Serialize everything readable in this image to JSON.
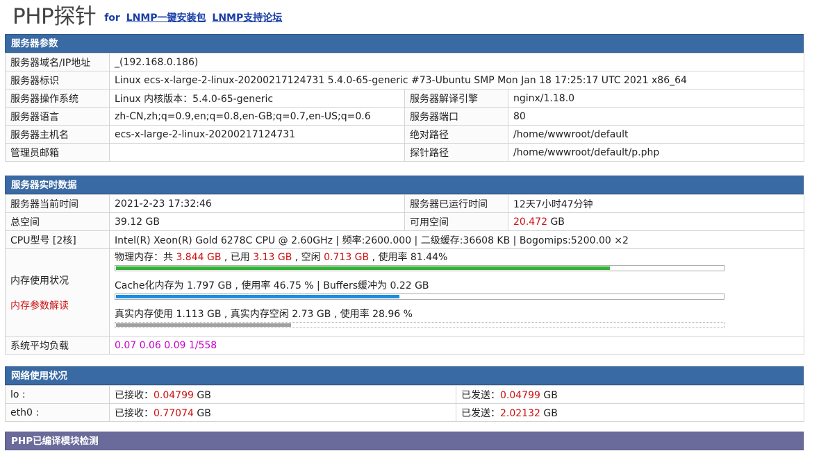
{
  "header": {
    "logo": "PHP探针",
    "for_text": "for",
    "link1": "LNMP一键安装包",
    "link2": "LNMP支持论坛"
  },
  "server_params": {
    "title": "服务器参数",
    "domain_label": "服务器域名/IP地址",
    "domain_value": "_(192.168.0.186)",
    "id_label": "服务器标识",
    "id_value": "Linux ecs-x-large-2-linux-20200217124731 5.4.0-65-generic #73-Ubuntu SMP Mon Jan 18 17:25:17 UTC 2021 x86_64",
    "os_label": "服务器操作系统",
    "os_value": "Linux  内核版本：5.4.0-65-generic",
    "engine_label": "服务器解译引擎",
    "engine_value": "nginx/1.18.0",
    "lang_label": "服务器语言",
    "lang_value": "zh-CN,zh;q=0.9,en;q=0.8,en-GB;q=0.7,en-US;q=0.6",
    "port_label": "服务器端口",
    "port_value": "80",
    "host_label": "服务器主机名",
    "host_value": "ecs-x-large-2-linux-20200217124731",
    "abspath_label": "绝对路径",
    "abspath_value": "/home/wwwroot/default",
    "email_label": "管理员邮箱",
    "email_value": "",
    "probe_label": "探针路径",
    "probe_value": "/home/wwwroot/default/p.php"
  },
  "realtime": {
    "title": "服务器实时数据",
    "time_label": "服务器当前时间",
    "time_value": "2021-2-23 17:32:46",
    "uptime_label": "服务器已运行时间",
    "uptime_value": "12天7小时47分钟",
    "total_label": "总空间",
    "total_value": "39.12 GB",
    "free_label": "可用空间",
    "free_value": "20.472",
    "free_unit": "GB",
    "cpu_label": "CPU型号 [2核]",
    "cpu_value": "Intel(R) Xeon(R) Gold 6278C CPU @ 2.60GHz | 频率:2600.000 | 二级缓存:36608 KB | Bogomips:5200.00 ×2",
    "mem_label": "内存使用状况",
    "mem_link": "内存参数解读",
    "mem_phys_prefix": "物理内存：共",
    "mem_phys_total": "3.844 GB",
    "mem_phys_used_label": ", 已用",
    "mem_phys_used": "3.13 GB",
    "mem_phys_free_label": ", 空闲",
    "mem_phys_free": "0.713 GB",
    "mem_phys_rate": ", 使用率 81.44%",
    "mem_phys_pct": 81.44,
    "mem_cache_text": "Cache化内存为 1.797 GB , 使用率 46.75 % | Buffers缓冲为 0.22 GB",
    "mem_cache_pct": 46.75,
    "mem_real_text": "真实内存使用 1.113 GB , 真实内存空闲 2.73 GB , 使用率 28.96 %",
    "mem_real_pct": 28.96,
    "load_label": "系统平均负载",
    "load_value": "0.07 0.06 0.09 1/558"
  },
  "network": {
    "title": "网络使用状况",
    "rows": [
      {
        "name": "lo :",
        "recv_label": "已接收：",
        "recv": "0.04799",
        "send_label": "已发送：",
        "send": "0.04799",
        "unit": "GB"
      },
      {
        "name": "eth0 :",
        "recv_label": "已接收：",
        "recv": "0.77074",
        "send_label": "已发送：",
        "send": "2.02132",
        "unit": "GB"
      }
    ]
  },
  "next_section": {
    "title": "PHP已编译模块检测"
  },
  "colors": {
    "header_blue": "#3a6aa3",
    "bar_green": "#33b233",
    "bar_blue": "#1a8ee0",
    "bar_gray": "#a0a0a0",
    "value_red": "#cc1111",
    "load_magenta": "#cc00cc"
  }
}
